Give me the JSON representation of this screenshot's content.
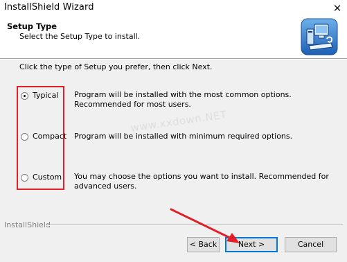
{
  "window": {
    "title": "InstallShield Wizard",
    "close_glyph": "✕"
  },
  "header": {
    "title": "Setup Type",
    "subtitle": "Select the Setup Type to install.",
    "icon": "computer-setup-icon"
  },
  "instruction": "Click the type of Setup you prefer, then click Next.",
  "options": [
    {
      "label": "Typical",
      "description": "Program will be installed with the most common options.  Recommended for most users.",
      "selected": true
    },
    {
      "label": "Compact",
      "description": "Program will be installed with minimum required options.",
      "selected": false
    },
    {
      "label": "Custom",
      "description": "You may choose the options you want to install. Recommended for advanced users.",
      "selected": false
    }
  ],
  "watermark": "www.xxdown.NET",
  "footer": {
    "brand": "InstallShield"
  },
  "buttons": {
    "back": "< Back",
    "next": "Next >",
    "cancel": "Cancel"
  },
  "colors": {
    "annotation_red": "#e21f26",
    "default_button_border": "#0078d7"
  }
}
